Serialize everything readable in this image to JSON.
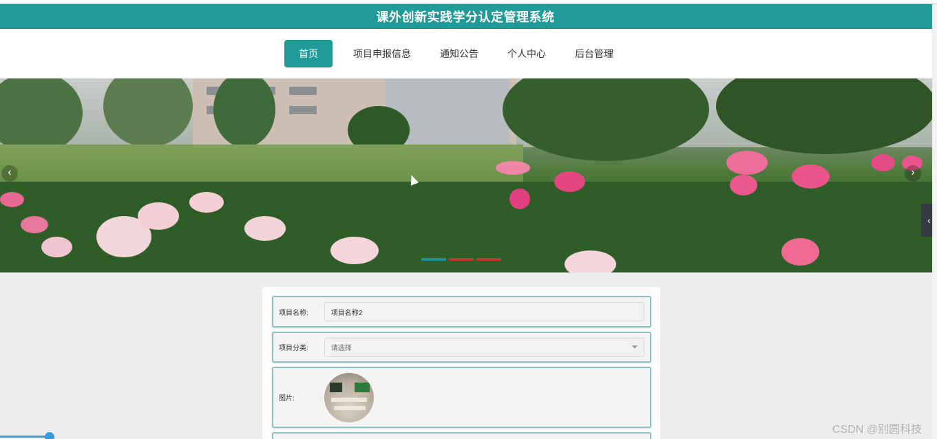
{
  "app": {
    "title": "课外创新实践学分认定管理系统",
    "theme_color": "#1f9a98"
  },
  "nav": {
    "items": [
      {
        "label": "首页",
        "active": true
      },
      {
        "label": "项目申报信息",
        "active": false
      },
      {
        "label": "通知公告",
        "active": false
      },
      {
        "label": "个人中心",
        "active": false
      },
      {
        "label": "后台管理",
        "active": false
      }
    ]
  },
  "banner": {
    "prev_icon": "chevron-left-icon",
    "next_icon": "chevron-right-icon",
    "prev_glyph": "‹",
    "next_glyph": "›",
    "side_tab_glyph": "‹",
    "active_slide_index": 0
  },
  "form": {
    "project_name": {
      "label": "项目名称:",
      "value": "项目名称2"
    },
    "project_category": {
      "label": "项目分类:",
      "placeholder": "请选择"
    },
    "image": {
      "label": "图片:"
    }
  },
  "watermark": "CSDN @别圆科技"
}
